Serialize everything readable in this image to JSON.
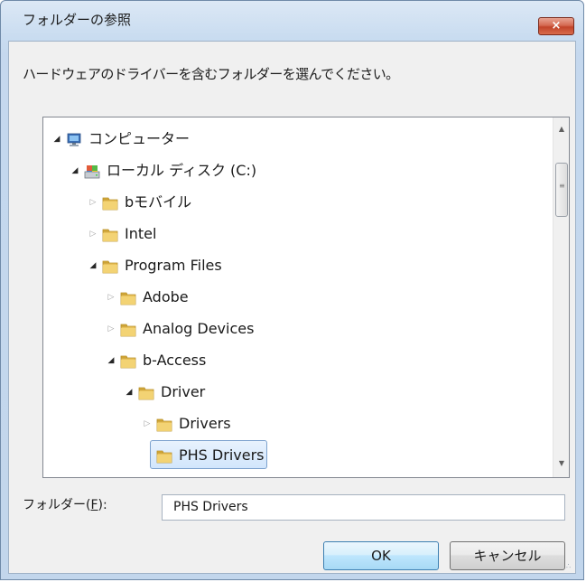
{
  "window": {
    "title": "フォルダーの参照",
    "close_label": "×"
  },
  "instruction": "ハードウェアのドライバーを含むフォルダーを選んでください。",
  "tree": {
    "items": [
      {
        "label": "コンピューター",
        "level": 0,
        "expanded": true,
        "icon": "computer-icon"
      },
      {
        "label": "ローカル ディスク (C:)",
        "level": 1,
        "expanded": true,
        "icon": "drive-icon"
      },
      {
        "label": "bモバイル",
        "level": 2,
        "expanded": false,
        "icon": "folder-icon"
      },
      {
        "label": "Intel",
        "level": 2,
        "expanded": false,
        "icon": "folder-icon"
      },
      {
        "label": "Program Files",
        "level": 2,
        "expanded": true,
        "icon": "folder-icon"
      },
      {
        "label": "Adobe",
        "level": 3,
        "expanded": false,
        "icon": "folder-icon"
      },
      {
        "label": "Analog Devices",
        "level": 3,
        "expanded": false,
        "icon": "folder-icon"
      },
      {
        "label": "b-Access",
        "level": 3,
        "expanded": true,
        "icon": "folder-icon"
      },
      {
        "label": "Driver",
        "level": 4,
        "expanded": true,
        "icon": "folder-icon"
      },
      {
        "label": "Drivers",
        "level": 5,
        "expanded": false,
        "icon": "folder-icon"
      },
      {
        "label": "PHS Drivers",
        "level": 5,
        "expanded": null,
        "icon": "folder-icon",
        "selected": true
      }
    ]
  },
  "folder_field": {
    "label_prefix": "フォルダー(",
    "label_key": "F",
    "label_suffix": "):",
    "value": "PHS Drivers"
  },
  "buttons": {
    "ok": "OK",
    "cancel": "キャンセル"
  },
  "colors": {
    "accent": "#3c7fb1",
    "title_bar": "#c9dcf0",
    "close_button": "#c1442a",
    "selection": "#d2e6fc"
  }
}
